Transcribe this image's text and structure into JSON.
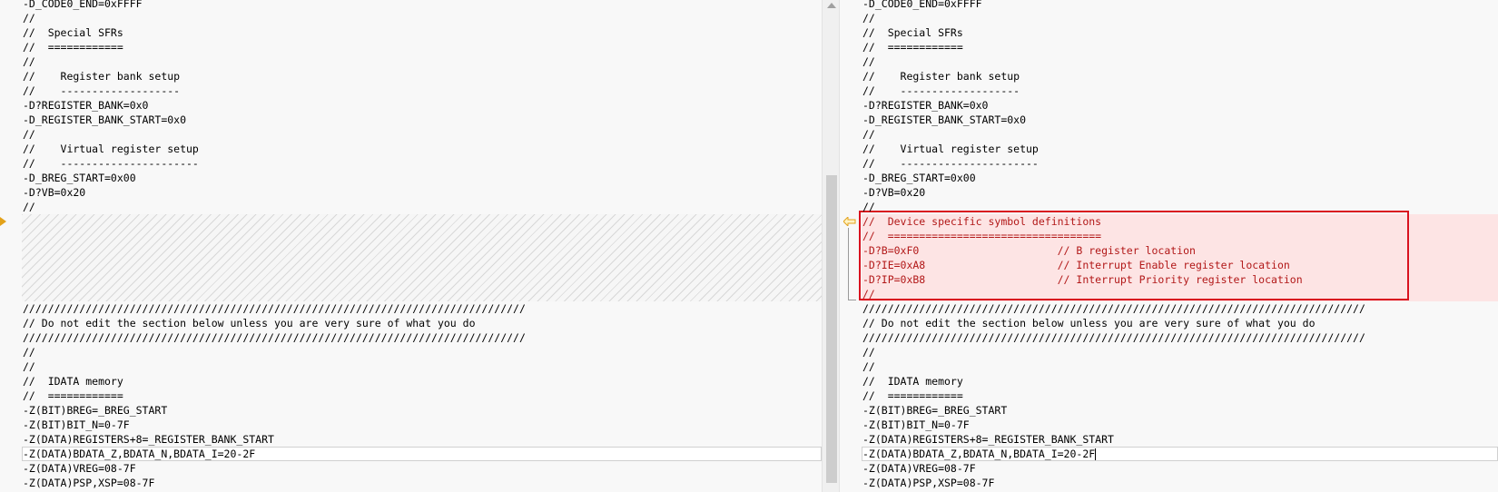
{
  "left_pane": {
    "top_lines": [
      "-D_CODE0_END=0xFFFF",
      "//",
      "//  Special SFRs",
      "//  ============",
      "//",
      "//    Register bank setup",
      "//    -------------------",
      "-D?REGISTER_BANK=0x0",
      "-D_REGISTER_BANK_START=0x0",
      "//",
      "//    Virtual register setup",
      "//    ----------------------",
      "-D_BREG_START=0x00",
      "-D?VB=0x20",
      "//"
    ],
    "bottom_lines": [
      "////////////////////////////////////////////////////////////////////////////////",
      "// Do not edit the section below unless you are very sure of what you do",
      "////////////////////////////////////////////////////////////////////////////////",
      "//",
      "//",
      "//  IDATA memory",
      "//  ============",
      "-Z(BIT)BREG=_BREG_START",
      "-Z(BIT)BIT_N=0-7F",
      "-Z(DATA)REGISTERS+8=_REGISTER_BANK_START",
      "-Z(DATA)BDATA_Z,BDATA_N,BDATA_I=20-2F",
      "-Z(DATA)VREG=08-7F",
      "-Z(DATA)PSP,XSP=08-7F"
    ]
  },
  "right_pane": {
    "top_lines": [
      "-D_CODE0_END=0xFFFF",
      "//",
      "//  Special SFRs",
      "//  ============",
      "//",
      "//    Register bank setup",
      "//    -------------------",
      "-D?REGISTER_BANK=0x0",
      "-D_REGISTER_BANK_START=0x0",
      "//",
      "//    Virtual register setup",
      "//    ----------------------",
      "-D_BREG_START=0x00",
      "-D?VB=0x20",
      "//"
    ],
    "added_lines": [
      "//  Device specific symbol definitions",
      "//  ==================================",
      "-D?B=0xF0                      // B register location",
      "-D?IE=0xA8                     // Interrupt Enable register location",
      "-D?IP=0xB8                     // Interrupt Priority register location",
      "//"
    ],
    "bottom_lines": [
      "////////////////////////////////////////////////////////////////////////////////",
      "// Do not edit the section below unless you are very sure of what you do",
      "////////////////////////////////////////////////////////////////////////////////",
      "//",
      "//",
      "//  IDATA memory",
      "//  ============",
      "-Z(BIT)BREG=_BREG_START",
      "-Z(BIT)BIT_N=0-7F",
      "-Z(DATA)REGISTERS+8=_REGISTER_BANK_START",
      "-Z(DATA)BDATA_Z,BDATA_N,BDATA_I=20-2F",
      "-Z(DATA)VREG=08-7F",
      "-Z(DATA)PSP,XSP=08-7F"
    ]
  },
  "colors": {
    "added_background": "#fde4e4",
    "added_border": "#d9121f",
    "added_text": "#b21818",
    "diff_marker": "#e3a21a"
  },
  "icons": {
    "left_diff_marker": "diff-arrow-right-icon",
    "right_diff_marker": "diff-arrow-left-icon"
  }
}
